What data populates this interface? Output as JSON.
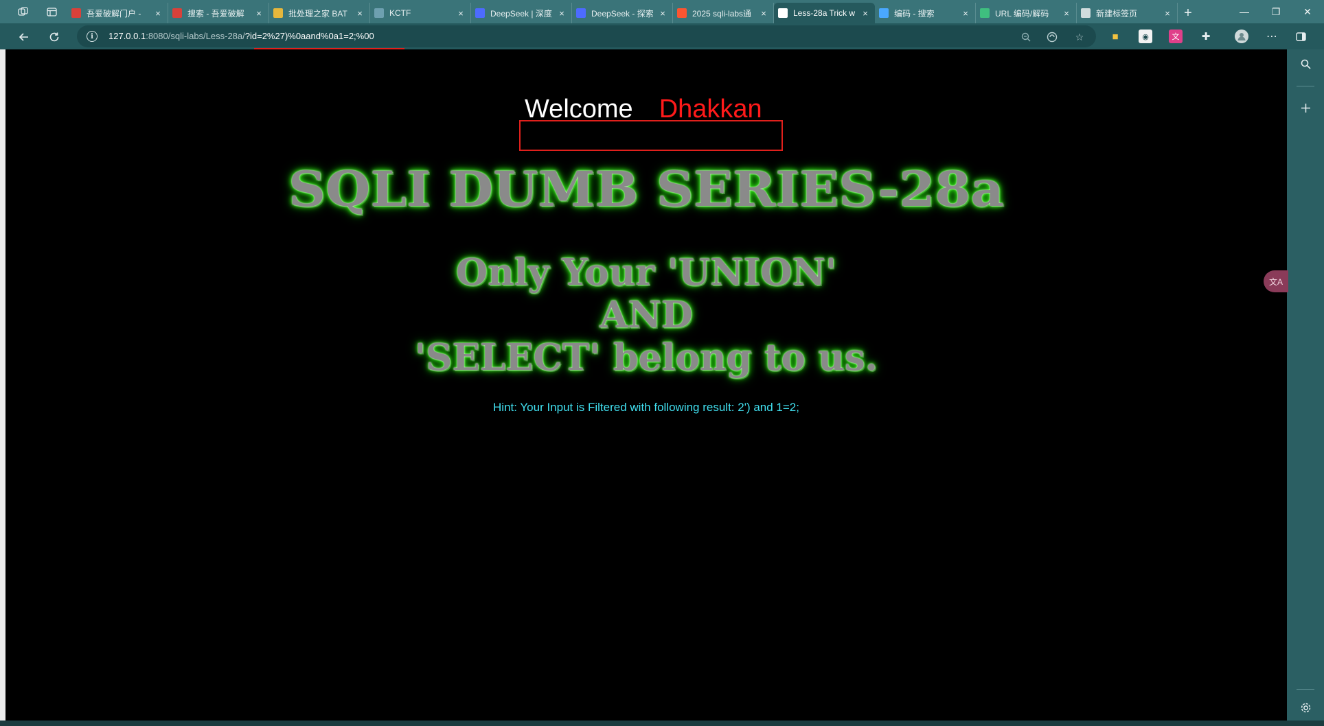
{
  "browser": {
    "tabs": [
      {
        "title": "吾爱破解门户 -",
        "favicon": "grid-favicon",
        "color": "#d9413a",
        "active": false
      },
      {
        "title": "搜索 - 吾爱破解",
        "favicon": "grid-favicon",
        "color": "#d9413a",
        "active": false
      },
      {
        "title": "批处理之家 BAT",
        "favicon": "folder-favicon",
        "color": "#e6b73c",
        "active": false
      },
      {
        "title": "KCTF",
        "favicon": "snowflake-favicon",
        "color": "#6ea0b0",
        "active": false
      },
      {
        "title": "DeepSeek | 深度",
        "favicon": "whale-favicon",
        "color": "#4d6bfe",
        "active": false
      },
      {
        "title": "DeepSeek - 探索",
        "favicon": "whale-favicon",
        "color": "#4d6bfe",
        "active": false
      },
      {
        "title": "2025 sqli-labs通",
        "favicon": "csdn-favicon",
        "color": "#fc5531",
        "active": false
      },
      {
        "title": "Less-28a Trick w",
        "favicon": "page-favicon",
        "color": "#ffffff",
        "active": true
      },
      {
        "title": "编码 - 搜索",
        "favicon": "search-favicon",
        "color": "#4aa8ff",
        "active": false
      },
      {
        "title": "URL 编码/解码",
        "favicon": "tool-favicon",
        "color": "#3fbf7f",
        "active": false
      },
      {
        "title": "新建标签页",
        "favicon": "newtab-favicon",
        "color": "#d0dcdd",
        "active": false
      }
    ],
    "tab_close_glyph": "×",
    "new_tab_glyph": "+",
    "window": {
      "minimize": "—",
      "restore": "❐",
      "close": "✕"
    },
    "address": {
      "host": "127.0.0.1",
      "path": ":8080/sqli-labs/Less-28a/",
      "query": "?id=2%27)%0aand%0a1=2;%00"
    }
  },
  "page": {
    "welcome": "Welcome",
    "name": "Dhakkan",
    "series_title": "SQLI DUMB SERIES-28a",
    "tagline_lines": [
      "Only Your 'UNION'",
      "AND",
      "'SELECT' belong to us."
    ],
    "hint": "Hint: Your Input is Filtered with following result: 2') and 1=2;"
  },
  "colors": {
    "page_bg": "#000000",
    "welcome": "#ffffff",
    "name": "#ff1a1a",
    "glow": "#39ff14",
    "hint": "#41e0f0",
    "highlight_box": "#e0201c",
    "chrome": "#2b5f63"
  }
}
